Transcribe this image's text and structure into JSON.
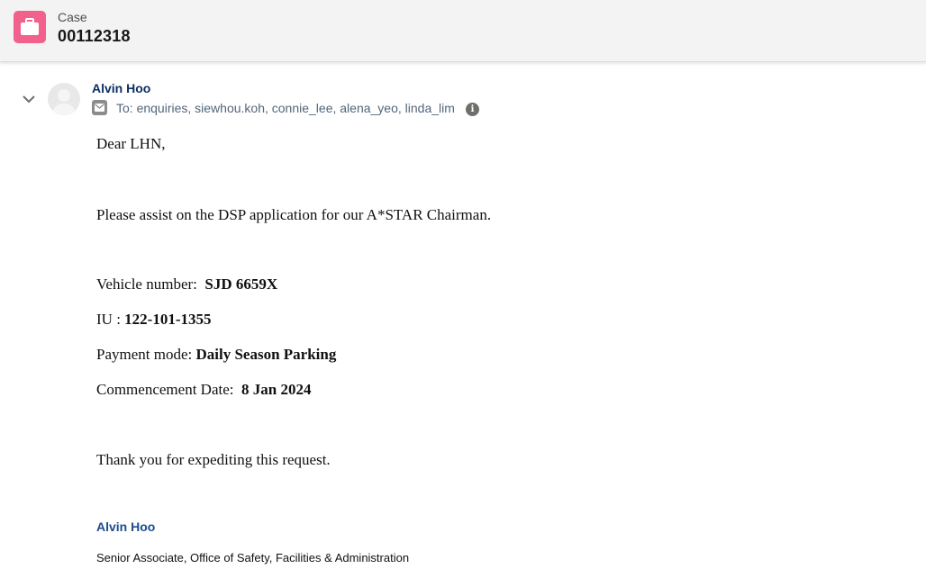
{
  "header": {
    "object_label": "Case",
    "case_number": "00112318",
    "icon": "briefcase-icon",
    "icon_color": "#f2608c"
  },
  "email": {
    "sender_name": "Alvin Hoo",
    "recipients": "To: enquiries, siewhou.koh, connie_lee, alena_yeo, linda_lim",
    "greeting": "Dear LHN,",
    "request": "Please assist on the DSP application for our A*STAR Chairman.",
    "fields": {
      "vehicle_label": "Vehicle number:  ",
      "vehicle_value": "SJD 6659X",
      "iu_label": "IU : ",
      "iu_value": "122-101-1355",
      "payment_label": "Payment mode: ",
      "payment_value": "Daily Season Parking",
      "date_label": "Commencement Date:  ",
      "date_value": "8 Jan 2024"
    },
    "closing": "Thank you for expediting this request.",
    "signature_name": "Alvin Hoo",
    "signature_title": "Senior Associate, Office of Safety, Facilities & Administration"
  }
}
